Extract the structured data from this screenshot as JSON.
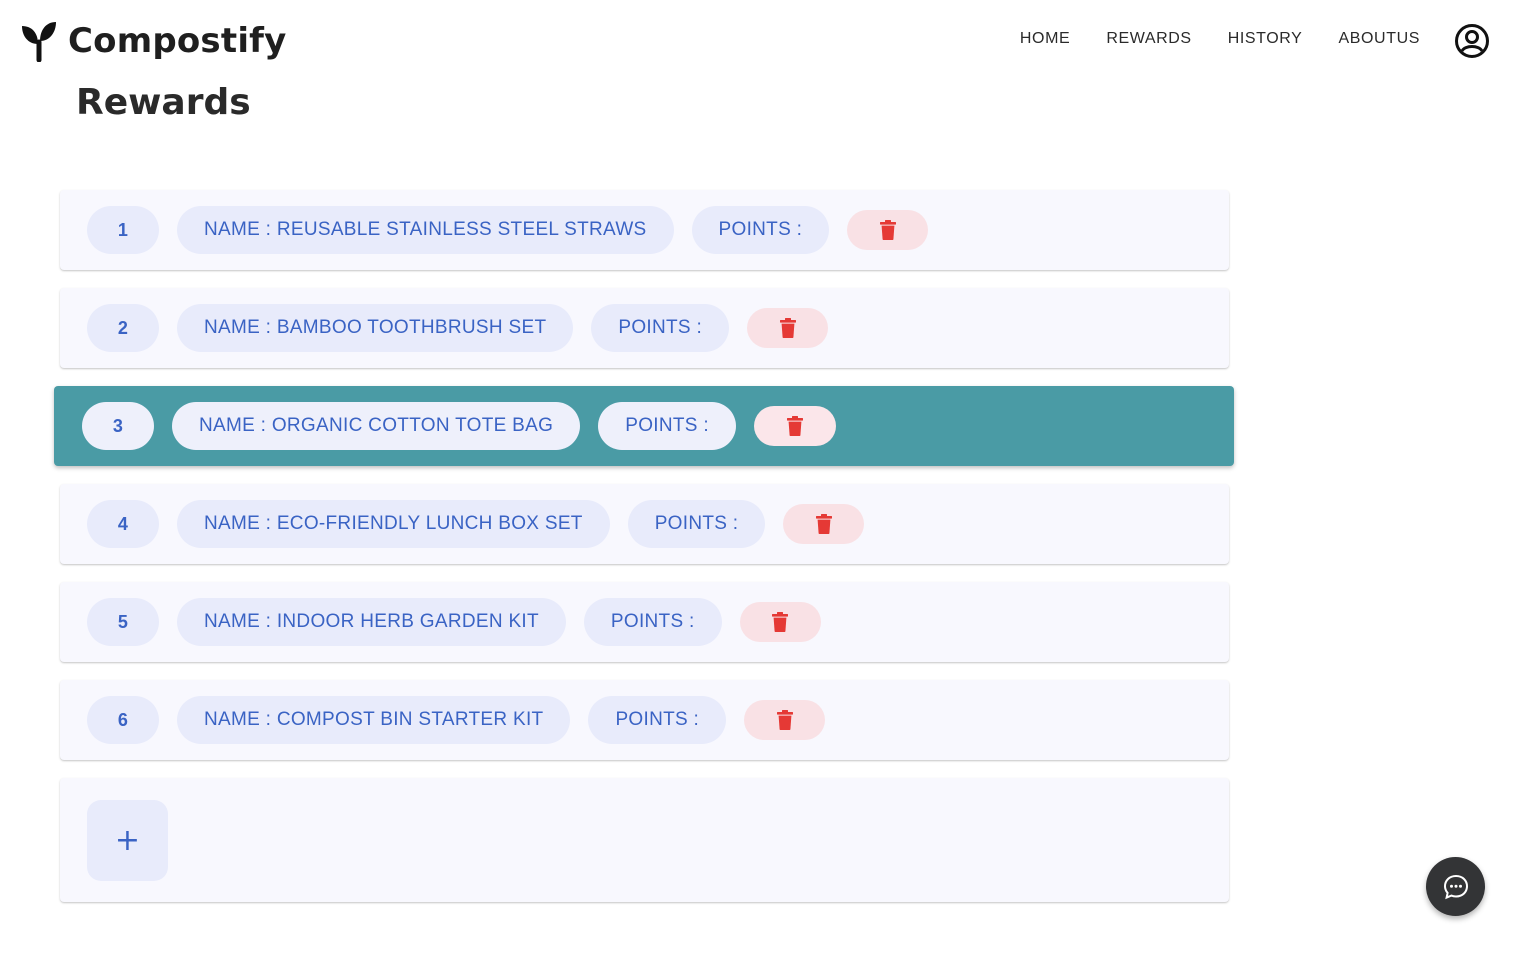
{
  "brand": {
    "name": "Compostify",
    "logo_icon": "sprout-icon"
  },
  "nav": {
    "items": [
      "HOME",
      "REWARDS",
      "HISTORY",
      "ABOUTUS"
    ],
    "profile_icon": "user-circle-icon"
  },
  "page": {
    "title": "Rewards"
  },
  "rewards": [
    {
      "index": "1",
      "name": "NAME : REUSABLE STAINLESS STEEL STRAWS",
      "points": "POINTS :",
      "selected": false
    },
    {
      "index": "2",
      "name": "NAME : BAMBOO TOOTHBRUSH SET",
      "points": "POINTS :",
      "selected": false
    },
    {
      "index": "3",
      "name": "NAME : ORGANIC COTTON TOTE BAG",
      "points": "POINTS :",
      "selected": true
    },
    {
      "index": "4",
      "name": "NAME : ECO-FRIENDLY LUNCH BOX SET",
      "points": "POINTS :",
      "selected": false
    },
    {
      "index": "5",
      "name": "NAME : INDOOR HERB GARDEN KIT",
      "points": "POINTS :",
      "selected": false
    },
    {
      "index": "6",
      "name": "NAME : COMPOST BIN STARTER KIT",
      "points": "POINTS :",
      "selected": false
    }
  ],
  "add_button": {
    "label": "+"
  },
  "chat": {
    "icon": "chat-bubble-icon"
  },
  "colors": {
    "accent_text": "#3a63c4",
    "chip_bg": "#e8ebfb",
    "selected_row": "#4a9ba5",
    "delete": "#e53935",
    "delete_bg": "#f9e1e5"
  }
}
